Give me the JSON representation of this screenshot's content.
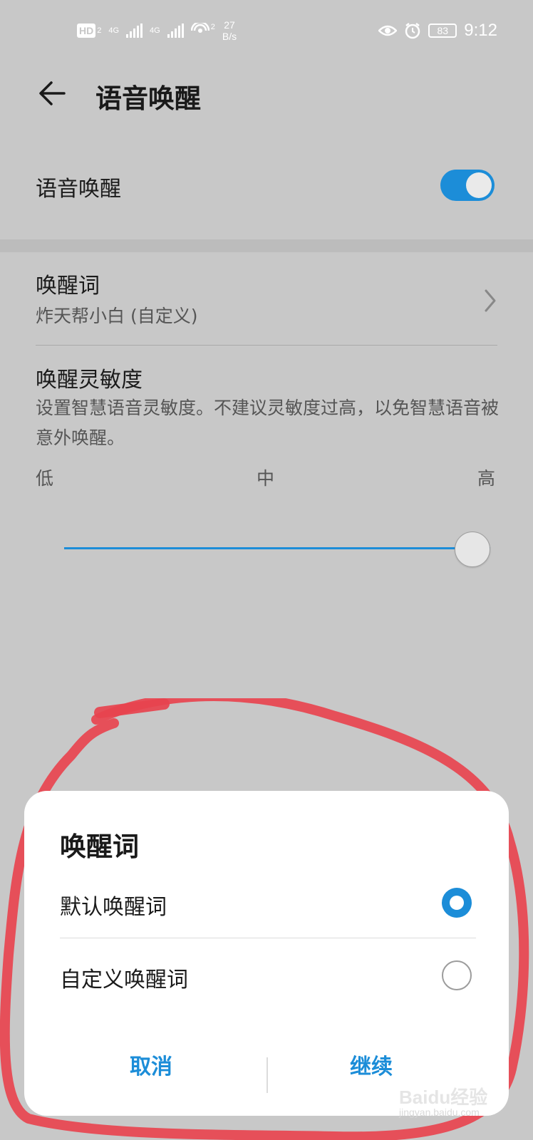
{
  "status_bar": {
    "hd_label": "HD",
    "hd_sub": "2",
    "sig1_label": "4G",
    "sig2_label": "4G",
    "wifi_sub": "2",
    "net_speed_value": "27",
    "net_speed_unit": "B/s",
    "battery": "83",
    "time": "9:12",
    "icons": [
      "eye-icon",
      "alarm-icon",
      "battery-icon"
    ]
  },
  "header": {
    "title": "语音唤醒"
  },
  "toggle_row": {
    "label": "语音唤醒",
    "on": true
  },
  "wake_word_row": {
    "title": "唤醒词",
    "value": "炸天帮小白 (自定义)"
  },
  "sensitivity": {
    "title": "唤醒灵敏度",
    "description": "设置智慧语音灵敏度。不建议灵敏度过高，以免智慧语音被意外唤醒。",
    "ticks": {
      "low": "低",
      "mid": "中",
      "high": "高"
    },
    "level": 1.0
  },
  "dialog": {
    "title": "唤醒词",
    "options": [
      {
        "label": "默认唤醒词",
        "selected": true
      },
      {
        "label": "自定义唤醒词",
        "selected": false
      }
    ],
    "cancel_label": "取消",
    "continue_label": "继续"
  },
  "colors": {
    "accent": "#1c8dd8",
    "overlay_bg": "#c8c8c8",
    "annotation": "#e8444f"
  },
  "watermark": {
    "main": "Baidu经验",
    "sub": "jingyan.baidu.com"
  }
}
